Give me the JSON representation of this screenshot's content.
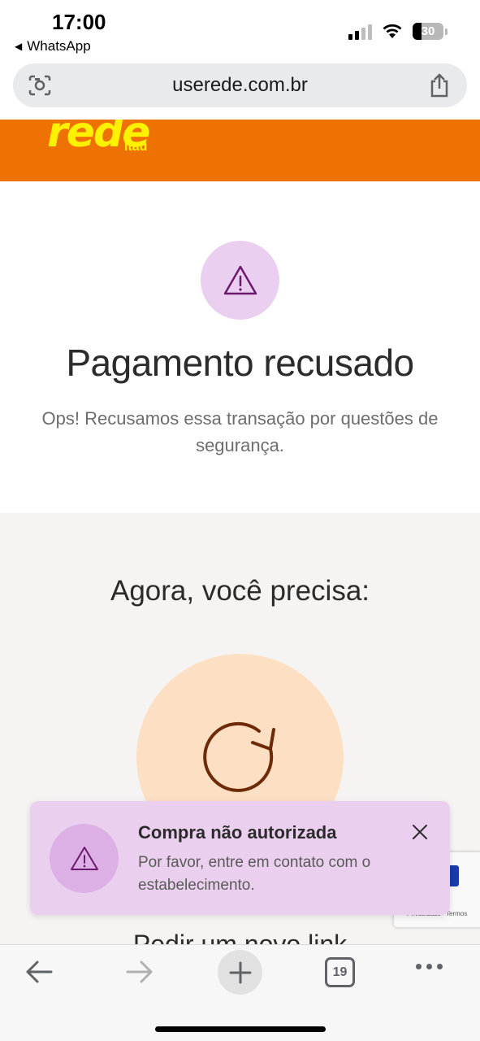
{
  "status_bar": {
    "time": "17:00",
    "back_app": "WhatsApp",
    "battery": "30"
  },
  "browser": {
    "url": "userede.com.br",
    "tabs_count": "19"
  },
  "site_header": {
    "logo": "rede",
    "logo_sub": "Itaú",
    "brand_color": "#ee7203",
    "logo_color": "#fff200"
  },
  "error": {
    "title": "Pagamento recusado",
    "description": "Ops! Recusamos essa transação por questões de segurança."
  },
  "next_steps": {
    "title": "Agora, você precisa:",
    "step_label": "Pedir um novo link"
  },
  "toast": {
    "title": "Compra não autorizada",
    "message": "Por favor, entre em contato com o estabelecimento."
  },
  "recaptcha": {
    "privacy": "Privacidade",
    "terms": "Termos"
  },
  "icons": {
    "warning": "warning-icon",
    "retry": "refresh-icon",
    "close": "close-icon",
    "share": "share-icon",
    "lens": "lens-icon",
    "back": "arrow-left-icon",
    "forward": "arrow-right-icon",
    "new_tab": "plus-icon",
    "more": "more-icon"
  }
}
